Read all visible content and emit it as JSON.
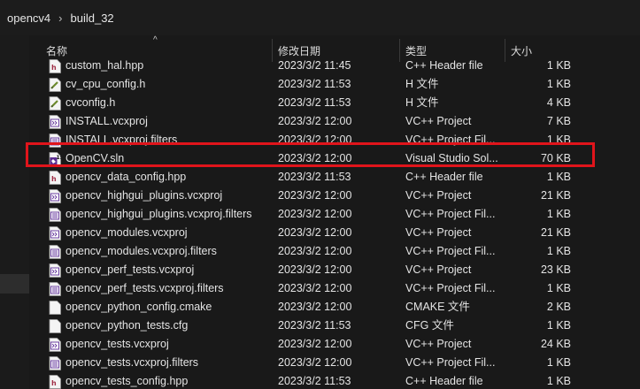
{
  "breadcrumb": {
    "items": [
      "opencv4",
      "build_32"
    ],
    "separator": "›"
  },
  "columns": {
    "name": "名称",
    "date": "修改日期",
    "type": "类型",
    "size": "大小"
  },
  "sort_arrow": "^",
  "rows": [
    {
      "name": "custom_hal.hpp",
      "date": "2023/3/2 11:45",
      "type": "C++ Header file",
      "size": "1 KB",
      "icon": "cpp-header-icon"
    },
    {
      "name": "cv_cpu_config.h",
      "date": "2023/3/2 11:53",
      "type": "H 文件",
      "size": "1 KB",
      "icon": "h-file-icon"
    },
    {
      "name": "cvconfig.h",
      "date": "2023/3/2 11:53",
      "type": "H 文件",
      "size": "4 KB",
      "icon": "h-file-icon"
    },
    {
      "name": "INSTALL.vcxproj",
      "date": "2023/3/2 12:00",
      "type": "VC++ Project",
      "size": "7 KB",
      "icon": "vcxproj-icon"
    },
    {
      "name": "INSTALL.vcxproj.filters",
      "date": "2023/3/2 12:00",
      "type": "VC++ Project Fil...",
      "size": "1 KB",
      "icon": "filters-icon"
    },
    {
      "name": "OpenCV.sln",
      "date": "2023/3/2 12:00",
      "type": "Visual Studio Sol...",
      "size": "70 KB",
      "icon": "sln-icon"
    },
    {
      "name": "opencv_data_config.hpp",
      "date": "2023/3/2 11:53",
      "type": "C++ Header file",
      "size": "1 KB",
      "icon": "cpp-header-icon"
    },
    {
      "name": "opencv_highgui_plugins.vcxproj",
      "date": "2023/3/2 12:00",
      "type": "VC++ Project",
      "size": "21 KB",
      "icon": "vcxproj-icon"
    },
    {
      "name": "opencv_highgui_plugins.vcxproj.filters",
      "date": "2023/3/2 12:00",
      "type": "VC++ Project Fil...",
      "size": "1 KB",
      "icon": "filters-icon"
    },
    {
      "name": "opencv_modules.vcxproj",
      "date": "2023/3/2 12:00",
      "type": "VC++ Project",
      "size": "21 KB",
      "icon": "vcxproj-icon"
    },
    {
      "name": "opencv_modules.vcxproj.filters",
      "date": "2023/3/2 12:00",
      "type": "VC++ Project Fil...",
      "size": "1 KB",
      "icon": "filters-icon"
    },
    {
      "name": "opencv_perf_tests.vcxproj",
      "date": "2023/3/2 12:00",
      "type": "VC++ Project",
      "size": "23 KB",
      "icon": "vcxproj-icon"
    },
    {
      "name": "opencv_perf_tests.vcxproj.filters",
      "date": "2023/3/2 12:00",
      "type": "VC++ Project Fil...",
      "size": "1 KB",
      "icon": "filters-icon"
    },
    {
      "name": "opencv_python_config.cmake",
      "date": "2023/3/2 12:00",
      "type": "CMAKE 文件",
      "size": "2 KB",
      "icon": "blank-file-icon"
    },
    {
      "name": "opencv_python_tests.cfg",
      "date": "2023/3/2 11:53",
      "type": "CFG 文件",
      "size": "1 KB",
      "icon": "blank-file-icon"
    },
    {
      "name": "opencv_tests.vcxproj",
      "date": "2023/3/2 12:00",
      "type": "VC++ Project",
      "size": "24 KB",
      "icon": "vcxproj-icon"
    },
    {
      "name": "opencv_tests.vcxproj.filters",
      "date": "2023/3/2 12:00",
      "type": "VC++ Project Fil...",
      "size": "1 KB",
      "icon": "filters-icon"
    },
    {
      "name": "opencv_tests_config.hpp",
      "date": "2023/3/2 11:53",
      "type": "C++ Header file",
      "size": "1 KB",
      "icon": "cpp-header-icon"
    }
  ],
  "highlighted_row": 5,
  "colors": {
    "highlight_border": "#e0141b",
    "background": "#191919",
    "text": "#e4e4e4"
  }
}
